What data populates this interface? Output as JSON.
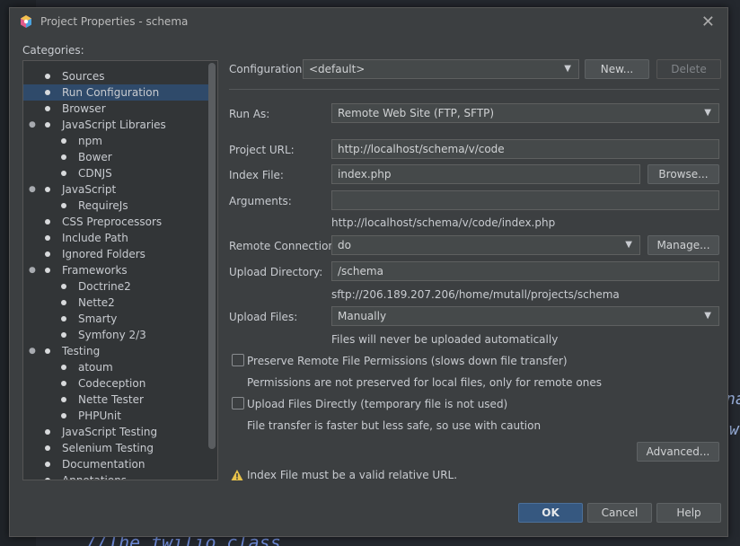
{
  "window": {
    "title": "Project Properties - schema"
  },
  "categories": {
    "label": "Categories:",
    "items": [
      {
        "label": "Sources",
        "level": 1,
        "selected": false,
        "expander": false
      },
      {
        "label": "Run Configuration",
        "level": 1,
        "selected": true,
        "expander": false
      },
      {
        "label": "Browser",
        "level": 1,
        "selected": false,
        "expander": false
      },
      {
        "label": "JavaScript Libraries",
        "level": 1,
        "selected": false,
        "expander": true
      },
      {
        "label": "npm",
        "level": 2,
        "selected": false,
        "expander": false
      },
      {
        "label": "Bower",
        "level": 2,
        "selected": false,
        "expander": false
      },
      {
        "label": "CDNJS",
        "level": 2,
        "selected": false,
        "expander": false
      },
      {
        "label": "JavaScript",
        "level": 1,
        "selected": false,
        "expander": true
      },
      {
        "label": "RequireJs",
        "level": 2,
        "selected": false,
        "expander": false
      },
      {
        "label": "CSS Preprocessors",
        "level": 1,
        "selected": false,
        "expander": false
      },
      {
        "label": "Include Path",
        "level": 1,
        "selected": false,
        "expander": false
      },
      {
        "label": "Ignored Folders",
        "level": 1,
        "selected": false,
        "expander": false
      },
      {
        "label": "Frameworks",
        "level": 1,
        "selected": false,
        "expander": true
      },
      {
        "label": "Doctrine2",
        "level": 2,
        "selected": false,
        "expander": false
      },
      {
        "label": "Nette2",
        "level": 2,
        "selected": false,
        "expander": false
      },
      {
        "label": "Smarty",
        "level": 2,
        "selected": false,
        "expander": false
      },
      {
        "label": "Symfony 2/3",
        "level": 2,
        "selected": false,
        "expander": false
      },
      {
        "label": "Testing",
        "level": 1,
        "selected": false,
        "expander": true
      },
      {
        "label": "atoum",
        "level": 2,
        "selected": false,
        "expander": false
      },
      {
        "label": "Codeception",
        "level": 2,
        "selected": false,
        "expander": false
      },
      {
        "label": "Nette Tester",
        "level": 2,
        "selected": false,
        "expander": false
      },
      {
        "label": "PHPUnit",
        "level": 2,
        "selected": false,
        "expander": false
      },
      {
        "label": "JavaScript Testing",
        "level": 1,
        "selected": false,
        "expander": false
      },
      {
        "label": "Selenium Testing",
        "level": 1,
        "selected": false,
        "expander": false
      },
      {
        "label": "Documentation",
        "level": 1,
        "selected": false,
        "expander": false
      },
      {
        "label": "Annotations",
        "level": 1,
        "selected": false,
        "expander": false
      }
    ]
  },
  "configuration": {
    "label": "Configuration:",
    "value": "<default>",
    "new_label": "New...",
    "delete_label": "Delete"
  },
  "form": {
    "run_as_label": "Run As:",
    "run_as_value": "Remote Web Site (FTP, SFTP)",
    "project_url_label": "Project URL:",
    "project_url_value": "http://localhost/schema/v/code",
    "index_file_label": "Index File:",
    "index_file_value": "index.php",
    "browse_label": "Browse...",
    "arguments_label": "Arguments:",
    "arguments_value": "",
    "full_url": "http://localhost/schema/v/code/index.php",
    "remote_connection_label": "Remote Connection:",
    "remote_connection_value": "do",
    "manage_label": "Manage...",
    "upload_directory_label": "Upload Directory:",
    "upload_directory_value": "/schema",
    "sftp_path": "sftp://206.189.207.206/home/mutall/projects/schema",
    "upload_files_label": "Upload Files:",
    "upload_files_value": "Manually",
    "upload_files_hint": "Files will never be uploaded automatically",
    "preserve_label": "Preserve Remote File Permissions (slows down file transfer)",
    "preserve_hint": "Permissions are not preserved for local files, only for remote ones",
    "upload_directly_label": "Upload Files Directly (temporary file is not used)",
    "upload_directly_hint": "File transfer is faster but less safe, so use with caution",
    "advanced_label": "Advanced...",
    "warning_text": "Index File must be a valid relative URL."
  },
  "footer": {
    "ok_label": "OK",
    "cancel_label": "Cancel",
    "help_label": "Help"
  },
  "editor": {
    "code_line": "//The twilio class"
  },
  "colors": {
    "accent": "#365880",
    "selection": "#2f4a6a",
    "warning": "#e8c24a",
    "background": "#3c3f41"
  }
}
